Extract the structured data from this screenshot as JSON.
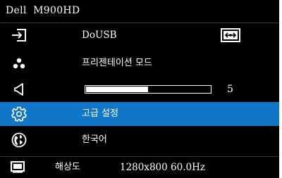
{
  "title": "Dell  M900HD",
  "menu": {
    "input_source": {
      "label": "DoUSB",
      "icon": "input-arrow-icon",
      "connection_icon": "usb-display-icon"
    },
    "presentation_mode": {
      "label": "프리젠테이션 모드",
      "icon": "three-dots-icon"
    },
    "volume": {
      "icon": "speaker-icon",
      "value": "5",
      "level": 0.5
    },
    "advanced_settings": {
      "label": "고급 설정",
      "icon": "gear-icon",
      "selected": true
    },
    "language": {
      "label": "한국어",
      "icon": "globe-icon"
    }
  },
  "status": {
    "icon": "screen-icon",
    "resolution_label": "해상도",
    "resolution_value": "1280x800 60.0Hz"
  },
  "colors": {
    "background": "#000000",
    "highlight": "#1276c8",
    "text": "#ffffff"
  }
}
